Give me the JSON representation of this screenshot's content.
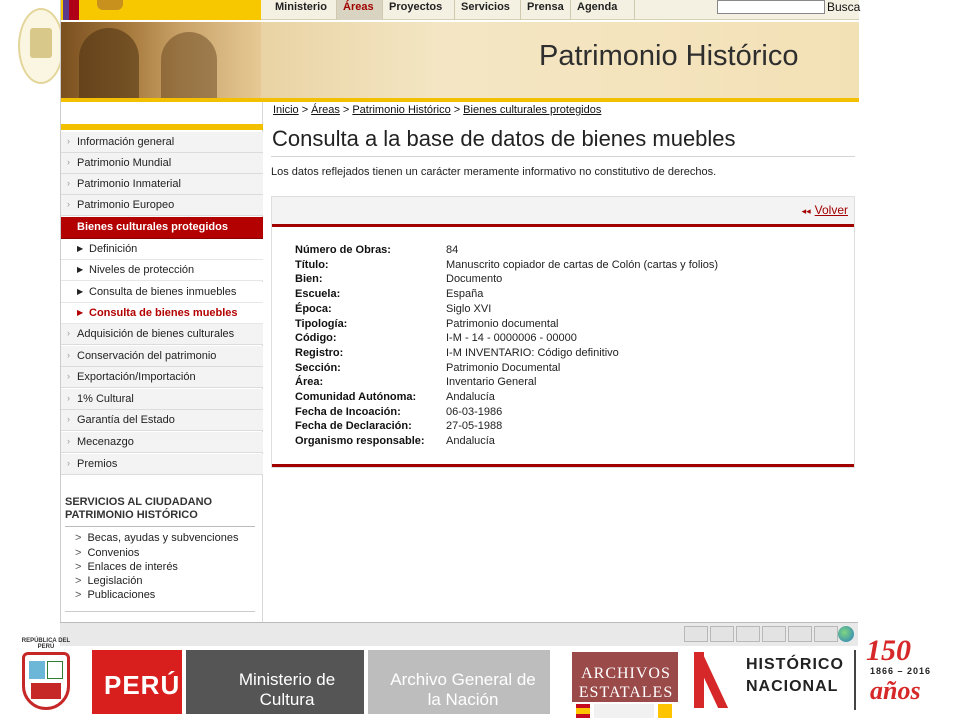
{
  "top_nav": {
    "tabs": [
      "Ministerio",
      "Áreas",
      "Proyectos",
      "Servicios",
      "Prensa",
      "Agenda"
    ],
    "active_tab": "Áreas",
    "search_label": "Busca"
  },
  "banner": {
    "title": "Patrimonio Histórico"
  },
  "sidebar": {
    "items_top": [
      "Información general",
      "Patrimonio Mundial",
      "Patrimonio Inmaterial",
      "Patrimonio Europeo"
    ],
    "active_item": "Bienes culturales protegidos",
    "sub_items": [
      "Definición",
      "Niveles de protección",
      "Consulta de bienes inmuebles",
      "Consulta de bienes muebles"
    ],
    "current_sub_item": "Consulta de bienes muebles",
    "items_bottom": [
      "Adquisición de bienes culturales",
      "Conservación del patrimonio",
      "Exportación/Importación",
      "1% Cultural",
      "Garantía del Estado",
      "Mecenazgo",
      "Premios"
    ],
    "services_title_line1": "SERVICIOS AL CIUDADANO",
    "services_title_line2": "PATRIMONIO HISTÓRICO",
    "services": [
      "Becas, ayudas y subvenciones",
      "Convenios",
      "Enlaces de interés",
      "Legislación",
      "Publicaciones"
    ]
  },
  "breadcrumb": [
    "Inicio",
    "Áreas",
    "Patrimonio Histórico",
    "Bienes culturales protegidos"
  ],
  "breadcrumb_separator": ">",
  "main": {
    "title": "Consulta a la base de datos de bienes muebles",
    "disclaimer": "Los datos reflejados tienen un carácter meramente informativo no constitutivo de derechos.",
    "back_link": "Volver",
    "record": [
      {
        "label": "Número de Obras:",
        "value": "84"
      },
      {
        "label": "Título:",
        "value": "Manuscrito copiador de cartas de Colón (cartas y folios)"
      },
      {
        "label": "Bien:",
        "value": "Documento"
      },
      {
        "label": "Escuela:",
        "value": "España"
      },
      {
        "label": "Época:",
        "value": "Siglo XVI"
      },
      {
        "label": "Tipología:",
        "value": "Patrimonio documental"
      },
      {
        "label": "Código:",
        "value": "I-M - 14 - 0000006 - 00000"
      },
      {
        "label": "Registro:",
        "value": "I-M INVENTARIO: Código definitivo"
      },
      {
        "label": "Sección:",
        "value": "Patrimonio Documental"
      },
      {
        "label": "Área:",
        "value": "Inventario General"
      },
      {
        "label": "Comunidad Autónoma:",
        "value": "Andalucía"
      },
      {
        "label": "Fecha de Incoación:",
        "value": "06-03-1986"
      },
      {
        "label": "Fecha de Declaración:",
        "value": "27-05-1988"
      },
      {
        "label": "Organismo responsable:",
        "value": "Andalucía"
      }
    ]
  },
  "footer": {
    "peru_crest_caption": "REPÚBLICA DEL PERÚ",
    "peru": "PERÚ",
    "ministerio": "Ministerio de Cultura",
    "archivo": "Archivo General de la Nación",
    "archivos_estatales": "ARCHIVOS ESTATALES",
    "historico_line1": "HISTÓRICO",
    "historico_line2": "NACIONAL",
    "anniversary_number": "150",
    "anniversary_years": "1866 – 2016",
    "anniversary_word": "años"
  },
  "colors": {
    "accent_red": "#b30000",
    "accent_yellow": "#f3c000",
    "peru_red": "#d91e1e"
  }
}
